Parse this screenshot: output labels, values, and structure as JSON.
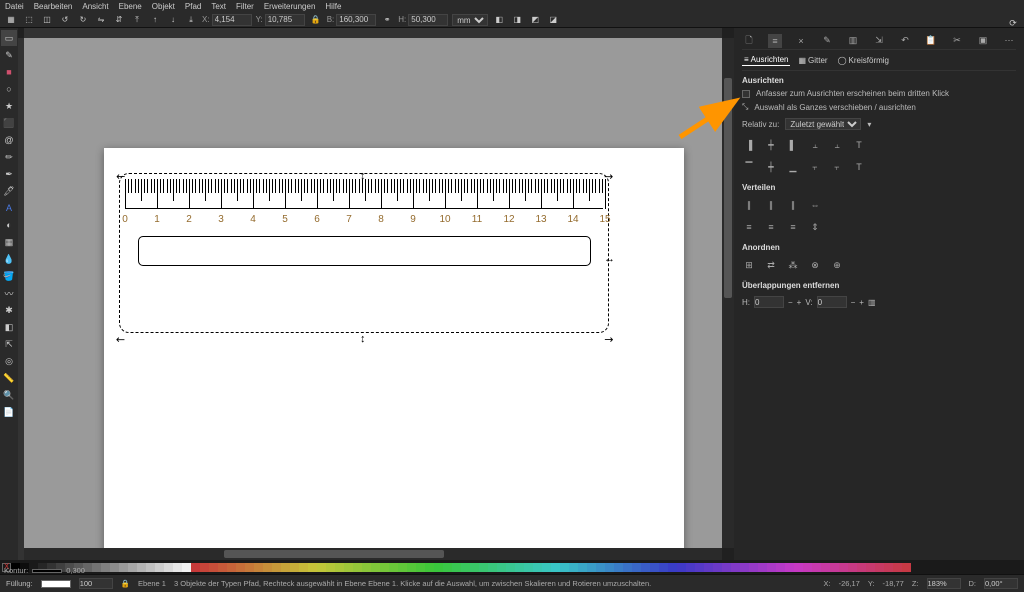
{
  "menu": [
    "Datei",
    "Bearbeiten",
    "Ansicht",
    "Ebene",
    "Objekt",
    "Pfad",
    "Text",
    "Filter",
    "Erweiterungen",
    "Hilfe"
  ],
  "toolbar": {
    "x_label": "X:",
    "x_val": "4,154",
    "y_label": "Y:",
    "y_val": "10,785",
    "w_label": "B:",
    "w_val": "160,300",
    "h_label": "H:",
    "h_val": "50,300",
    "unit": "mm"
  },
  "panel": {
    "tabs": {
      "align": "Ausrichten",
      "grid": "Gitter",
      "circular": "Kreisförmig"
    },
    "sect_align": "Ausrichten",
    "opt1": "Anfasser zum Ausrichten erscheinen beim dritten Klick",
    "opt2": "Auswahl als Ganzes verschieben / ausrichten",
    "relative_lbl": "Relativ zu:",
    "relative_val": "Zuletzt gewählt",
    "sect_dist": "Verteilen",
    "sect_arr": "Anordnen",
    "sect_over": "Überlappungen entfernen",
    "h_lbl": "H:",
    "h_val": "0",
    "v_lbl": "V:",
    "v_val": "0"
  },
  "ruler_nums": [
    "0",
    "1",
    "2",
    "3",
    "4",
    "5",
    "6",
    "7",
    "8",
    "9",
    "10",
    "11",
    "12",
    "13",
    "14",
    "15"
  ],
  "status": {
    "fill": "Füllung:",
    "stroke": "Kontur:",
    "stroke_val": "0,300",
    "opacity": "100",
    "layer": "Ebene 1",
    "msg": "3 Objekte der Typen Pfad, Rechteck ausgewählt in Ebene Ebene 1. Klicke auf die Auswahl, um zwischen Skalieren und Rotieren umzuschalten.",
    "coord_x": "X:",
    "coord_x_val": "-26,17",
    "coord_y": "Y:",
    "coord_y_val": "-18,77",
    "zoom": "Z:",
    "zoom_val": "183%",
    "rot": "D:",
    "rot_val": "0,00°"
  },
  "chart_data": null
}
